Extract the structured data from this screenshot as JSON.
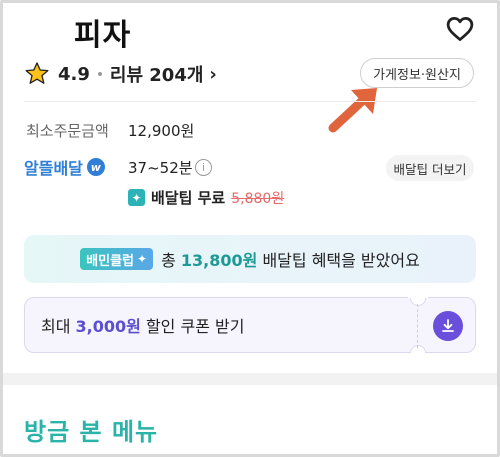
{
  "store": {
    "name": "피자",
    "rating": "4.9",
    "review_label": "리뷰 204개",
    "info_button": "가게정보·원산지"
  },
  "order": {
    "min_order_label": "최소주문금액",
    "min_order_value": "12,900원",
    "delivery_brand": "알뜰배달",
    "delivery_brand_badge": "w",
    "delivery_time": "37~52분",
    "tip_more_button": "배달팁 더보기",
    "free_tip_label": "배달팁 무료",
    "original_tip": "5,880원"
  },
  "club_banner": {
    "badge": "배민클럽",
    "prefix": "총 ",
    "amount": "13,800원",
    "suffix": " 배달팁 혜택을 받았어요"
  },
  "coupon": {
    "prefix": "최대 ",
    "amount": "3,000원",
    "suffix": " 할인 쿠폰 받기"
  },
  "section": {
    "title": "방금 본 메뉴"
  },
  "colors": {
    "brand_blue": "#2f7fd6",
    "mint": "#2ab3a8",
    "purple": "#6a4fdc",
    "strike_red": "#e56a6a",
    "annotation_arrow": "#e0643c"
  },
  "icons": [
    "heart-icon",
    "star-icon",
    "chevron-right-icon",
    "info-icon",
    "sparkle-icon",
    "download-icon"
  ]
}
